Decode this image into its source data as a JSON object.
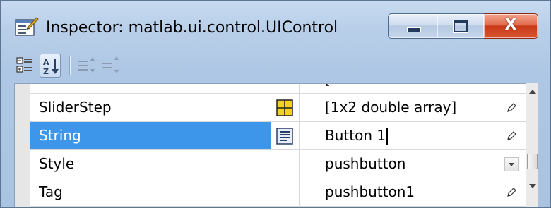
{
  "window": {
    "title": "Inspector:  matlab.ui.control.UIControl",
    "icons": {
      "app": "inspector-icon",
      "minimize": "minimize-icon",
      "maximize": "maximize-icon",
      "close": "close-icon",
      "close_glyph": "X"
    }
  },
  "toolbar": {
    "buttons": [
      {
        "icon": "categorized-view-icon",
        "pressed": false
      },
      {
        "icon": "sort-alphabetical-icon",
        "pressed": true
      },
      {
        "icon": "expand-all-icon",
        "pressed": false
      },
      {
        "icon": "collapse-all-icon",
        "pressed": false
      }
    ]
  },
  "properties": {
    "rows": [
      {
        "name": "",
        "value": "[",
        "edit_icon": "",
        "selected": false,
        "action": "none"
      },
      {
        "name": "SliderStep",
        "value": "[1x2  double array]",
        "edit_icon": "array-editor-icon",
        "selected": false,
        "action": "pencil"
      },
      {
        "name": "String",
        "value": "Button 1",
        "edit_icon": "text-editor-icon",
        "selected": true,
        "action": "pencil"
      },
      {
        "name": "Style",
        "value": "pushbutton",
        "edit_icon": "",
        "selected": false,
        "action": "dropdown"
      },
      {
        "name": "Tag",
        "value": "pushbutton1",
        "edit_icon": "",
        "selected": false,
        "action": "pencil"
      }
    ]
  },
  "colors": {
    "selection": "#3d96ea",
    "window_frame": "#a9c3e1",
    "close_button": "#c9391a"
  }
}
